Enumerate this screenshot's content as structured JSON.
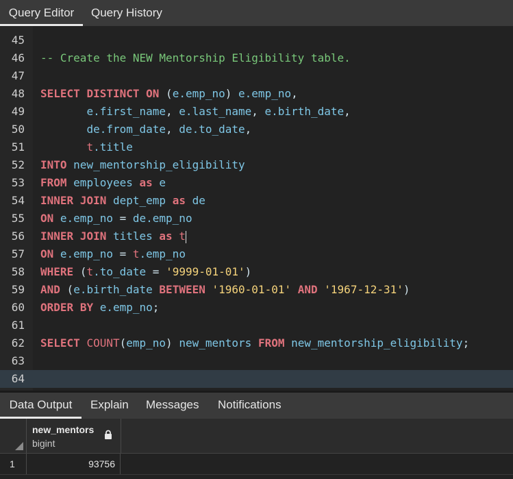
{
  "top_tabs": [
    {
      "label": "Query Editor",
      "active": true
    },
    {
      "label": "Query History",
      "active": false
    }
  ],
  "editor": {
    "lines": [
      {
        "num": "45",
        "tokens": []
      },
      {
        "num": "46",
        "tokens": [
          {
            "t": "cm",
            "v": "-- Create the NEW Mentorship Eligibility table."
          }
        ]
      },
      {
        "num": "47",
        "tokens": []
      },
      {
        "num": "48",
        "tokens": [
          {
            "t": "kw",
            "v": "SELECT"
          },
          {
            "t": "pad",
            "v": " "
          },
          {
            "t": "kw",
            "v": "DISTINCT"
          },
          {
            "t": "pad",
            "v": " "
          },
          {
            "t": "kw",
            "v": "ON"
          },
          {
            "t": "pad",
            "v": " "
          },
          {
            "t": "punc",
            "v": "("
          },
          {
            "t": "id",
            "v": "e.emp_no"
          },
          {
            "t": "punc",
            "v": ")"
          },
          {
            "t": "pad",
            "v": " "
          },
          {
            "t": "id",
            "v": "e.emp_no"
          },
          {
            "t": "punc",
            "v": ","
          }
        ]
      },
      {
        "num": "49",
        "tokens": [
          {
            "t": "pad",
            "v": "       "
          },
          {
            "t": "id",
            "v": "e.first_name"
          },
          {
            "t": "punc",
            "v": ", "
          },
          {
            "t": "id",
            "v": "e.last_name"
          },
          {
            "t": "punc",
            "v": ", "
          },
          {
            "t": "id",
            "v": "e.birth_date"
          },
          {
            "t": "punc",
            "v": ","
          }
        ]
      },
      {
        "num": "50",
        "tokens": [
          {
            "t": "pad",
            "v": "       "
          },
          {
            "t": "id",
            "v": "de.from_date"
          },
          {
            "t": "punc",
            "v": ", "
          },
          {
            "t": "id",
            "v": "de.to_date"
          },
          {
            "t": "punc",
            "v": ","
          }
        ]
      },
      {
        "num": "51",
        "tokens": [
          {
            "t": "pad",
            "v": "       "
          },
          {
            "t": "fn",
            "v": "t"
          },
          {
            "t": "id",
            "v": ".title"
          }
        ]
      },
      {
        "num": "52",
        "tokens": [
          {
            "t": "kw",
            "v": "INTO"
          },
          {
            "t": "pad",
            "v": " "
          },
          {
            "t": "id",
            "v": "new_mentorship_eligibility"
          }
        ]
      },
      {
        "num": "53",
        "tokens": [
          {
            "t": "kw",
            "v": "FROM"
          },
          {
            "t": "pad",
            "v": " "
          },
          {
            "t": "id",
            "v": "employees"
          },
          {
            "t": "pad",
            "v": " "
          },
          {
            "t": "kw",
            "v": "as"
          },
          {
            "t": "pad",
            "v": " "
          },
          {
            "t": "id",
            "v": "e"
          }
        ]
      },
      {
        "num": "54",
        "tokens": [
          {
            "t": "kw",
            "v": "INNER"
          },
          {
            "t": "pad",
            "v": " "
          },
          {
            "t": "kw",
            "v": "JOIN"
          },
          {
            "t": "pad",
            "v": " "
          },
          {
            "t": "id",
            "v": "dept_emp"
          },
          {
            "t": "pad",
            "v": " "
          },
          {
            "t": "kw",
            "v": "as"
          },
          {
            "t": "pad",
            "v": " "
          },
          {
            "t": "id",
            "v": "de"
          }
        ]
      },
      {
        "num": "55",
        "tokens": [
          {
            "t": "kw",
            "v": "ON"
          },
          {
            "t": "pad",
            "v": " "
          },
          {
            "t": "id",
            "v": "e.emp_no"
          },
          {
            "t": "op",
            "v": " = "
          },
          {
            "t": "id",
            "v": "de.emp_no"
          }
        ]
      },
      {
        "num": "56",
        "tokens": [
          {
            "t": "kw",
            "v": "INNER"
          },
          {
            "t": "pad",
            "v": " "
          },
          {
            "t": "kw",
            "v": "JOIN"
          },
          {
            "t": "pad",
            "v": " "
          },
          {
            "t": "id",
            "v": "titles"
          },
          {
            "t": "pad",
            "v": " "
          },
          {
            "t": "kw",
            "v": "as"
          },
          {
            "t": "pad",
            "v": " "
          },
          {
            "t": "fn",
            "v": "t"
          }
        ],
        "cursor": true
      },
      {
        "num": "57",
        "tokens": [
          {
            "t": "kw",
            "v": "ON"
          },
          {
            "t": "pad",
            "v": " "
          },
          {
            "t": "id",
            "v": "e.emp_no"
          },
          {
            "t": "op",
            "v": " = "
          },
          {
            "t": "fn",
            "v": "t"
          },
          {
            "t": "id",
            "v": ".emp_no"
          }
        ]
      },
      {
        "num": "58",
        "tokens": [
          {
            "t": "kw",
            "v": "WHERE"
          },
          {
            "t": "pad",
            "v": " "
          },
          {
            "t": "punc",
            "v": "("
          },
          {
            "t": "fn",
            "v": "t"
          },
          {
            "t": "id",
            "v": ".to_date"
          },
          {
            "t": "op",
            "v": " = "
          },
          {
            "t": "str",
            "v": "'9999-01-01'"
          },
          {
            "t": "punc",
            "v": ")"
          }
        ]
      },
      {
        "num": "59",
        "tokens": [
          {
            "t": "kw",
            "v": "AND"
          },
          {
            "t": "pad",
            "v": " "
          },
          {
            "t": "punc",
            "v": "("
          },
          {
            "t": "id",
            "v": "e.birth_date"
          },
          {
            "t": "pad",
            "v": " "
          },
          {
            "t": "kw",
            "v": "BETWEEN"
          },
          {
            "t": "pad",
            "v": " "
          },
          {
            "t": "str",
            "v": "'1960-01-01'"
          },
          {
            "t": "pad",
            "v": " "
          },
          {
            "t": "kw",
            "v": "AND"
          },
          {
            "t": "pad",
            "v": " "
          },
          {
            "t": "str",
            "v": "'1967-12-31'"
          },
          {
            "t": "punc",
            "v": ")"
          }
        ]
      },
      {
        "num": "60",
        "tokens": [
          {
            "t": "kw",
            "v": "ORDER"
          },
          {
            "t": "pad",
            "v": " "
          },
          {
            "t": "kw",
            "v": "BY"
          },
          {
            "t": "pad",
            "v": " "
          },
          {
            "t": "id",
            "v": "e.emp_no"
          },
          {
            "t": "punc",
            "v": ";"
          }
        ]
      },
      {
        "num": "61",
        "tokens": []
      },
      {
        "num": "62",
        "tokens": [
          {
            "t": "kw",
            "v": "SELECT"
          },
          {
            "t": "pad",
            "v": " "
          },
          {
            "t": "fn",
            "v": "COUNT"
          },
          {
            "t": "punc",
            "v": "("
          },
          {
            "t": "id",
            "v": "emp_no"
          },
          {
            "t": "punc",
            "v": ")"
          },
          {
            "t": "pad",
            "v": " "
          },
          {
            "t": "id",
            "v": "new_mentors"
          },
          {
            "t": "pad",
            "v": " "
          },
          {
            "t": "kw",
            "v": "FROM"
          },
          {
            "t": "pad",
            "v": " "
          },
          {
            "t": "id",
            "v": "new_mentorship_eligibility"
          },
          {
            "t": "punc",
            "v": ";"
          }
        ]
      },
      {
        "num": "63",
        "tokens": []
      },
      {
        "num": "64",
        "tokens": [],
        "current": true
      }
    ]
  },
  "output_tabs": [
    {
      "label": "Data Output",
      "active": true
    },
    {
      "label": "Explain",
      "active": false
    },
    {
      "label": "Messages",
      "active": false
    },
    {
      "label": "Notifications",
      "active": false
    }
  ],
  "result": {
    "column_name": "new_mentors",
    "column_type": "bigint",
    "rows": [
      {
        "row_number": "1",
        "value": "93756"
      }
    ]
  },
  "icons": {
    "lock": "lock-icon",
    "select_all": "select-all-corner-icon"
  },
  "colors": {
    "keyword": "#e0737d",
    "identifier": "#7fc7e6",
    "string": "#f5d37b",
    "comment": "#79c87a"
  }
}
